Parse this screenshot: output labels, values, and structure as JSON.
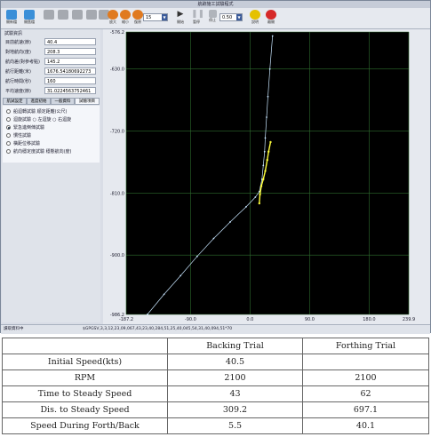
{
  "window": {
    "title": "航跡施工試驗程式",
    "toolbar": {
      "buttons": [
        {
          "label": "開新檔",
          "icon": "new-file-icon",
          "color": "#3a8fd8"
        },
        {
          "label": "開舊檔",
          "icon": "open-file-icon",
          "color": "#3a8fd8"
        },
        {
          "label": "",
          "icon": "cancel-icon",
          "color": "#a5a9b0"
        },
        {
          "label": "",
          "icon": "delete-icon",
          "color": "#a5a9b0"
        },
        {
          "label": "",
          "icon": "stop-icon",
          "color": "#a5a9b0"
        },
        {
          "label": "",
          "icon": "export-icon",
          "color": "#a5a9b0"
        },
        {
          "label": "",
          "icon": "print-icon",
          "color": "#a5a9b0"
        },
        {
          "label": "放大",
          "icon": "zoom-in-icon",
          "color": "#e07a1f"
        },
        {
          "label": "縮小",
          "icon": "zoom-out-icon",
          "color": "#e07a1f"
        },
        {
          "label": "復原",
          "icon": "reset-view-icon",
          "color": "#e07a1f"
        }
      ],
      "zoom_value": "15",
      "playback": [
        {
          "label": "開始",
          "icon": "play-icon",
          "color": "#333333"
        },
        {
          "label": "暫停",
          "icon": "pause-icon",
          "color": "#b0b4bb"
        },
        {
          "label": "停止",
          "icon": "stop-square-icon",
          "color": "#b0b4bb"
        }
      ],
      "speed_value": "0.50",
      "extra": [
        {
          "label": "說明",
          "icon": "help-icon",
          "color": "#e5c100"
        },
        {
          "label": "離開",
          "icon": "exit-icon",
          "color": "#d62828"
        }
      ]
    },
    "info_panel": {
      "title": "試驗資訊",
      "rows": [
        {
          "label": "目前航速(節)",
          "value": "40.4"
        },
        {
          "label": "對地航向(度)",
          "value": "208.3"
        },
        {
          "label": "航向差(對參考點)",
          "value": "145.2"
        },
        {
          "label": "航行距離(米)",
          "value": "1676.54180692273"
        },
        {
          "label": "航行時間(秒)",
          "value": "160"
        },
        {
          "label": "平均速度(節)",
          "value": "31.0224563752461"
        }
      ]
    },
    "tabs": [
      "航試設定",
      "進度初始",
      "一般資料",
      "試驗項目"
    ],
    "active_tab_index": 3,
    "test_items": [
      {
        "label": "船迴轉試驗   順定距離(公尺)",
        "checked": false
      },
      {
        "label": "迴旋試驗   ○ 左迴旋  ○ 右迴旋",
        "checked": false
      },
      {
        "label": "緊急進倒俥試驗",
        "checked": true
      },
      {
        "label": "慣性試驗",
        "checked": false
      },
      {
        "label": "橫距位移試驗",
        "checked": false
      },
      {
        "label": "航向穩定度試驗 穩態航向(度)",
        "checked": false
      }
    ],
    "plot": {
      "x_ticks": [
        "-187.2",
        "-90.0",
        "0.0",
        "90.0",
        "180.0",
        "239.9"
      ],
      "y_ticks": [
        "-576.2",
        "-630.0",
        "-720.0",
        "-810.0",
        "-900.0",
        "-986.2"
      ],
      "track_color": "#c8e6ff",
      "active_track_color": "#ffff3c"
    },
    "status_left": "讀取資料中",
    "status_right": "$GPGSV,3,3,12,23,09,067,43,23,40,284,51,25,40,045,54,31,40,094,51*70"
  },
  "chart_data": {
    "type": "line",
    "xlim": [
      -187.2,
      239.9
    ],
    "ylim": [
      -986.2,
      -576.2
    ],
    "x_ticks": [
      -187.2,
      -90.0,
      0.0,
      90.0,
      180.0,
      239.9
    ],
    "y_ticks": [
      -576.2,
      -630.0,
      -720.0,
      -810.0,
      -900.0,
      -986.2
    ],
    "series": [
      {
        "color": "#c8e6ff",
        "points": [
          [
            -155,
            -986
          ],
          [
            -130,
            -957
          ],
          [
            -105,
            -930
          ],
          [
            -80,
            -902
          ],
          [
            -55,
            -876
          ],
          [
            -30,
            -852
          ],
          [
            -6,
            -830
          ],
          [
            8,
            -816
          ],
          [
            14,
            -808
          ],
          [
            18,
            -790
          ],
          [
            20,
            -770
          ],
          [
            22,
            -750
          ],
          [
            23,
            -730
          ],
          [
            25,
            -700
          ],
          [
            27,
            -670
          ],
          [
            30,
            -630
          ],
          [
            34,
            -582
          ]
        ]
      },
      {
        "color": "#ffff3c",
        "points": [
          [
            14,
            -825
          ],
          [
            15,
            -812
          ],
          [
            17,
            -800
          ],
          [
            20,
            -790
          ],
          [
            23,
            -778
          ],
          [
            26,
            -762
          ],
          [
            28,
            -750
          ],
          [
            31,
            -736
          ]
        ]
      }
    ]
  },
  "table": {
    "headers": [
      "",
      "Backing Trial",
      "Forthing Trial"
    ],
    "rows": [
      {
        "label": "Initial Speed(kts)",
        "backing": "40.5",
        "forthing": ""
      },
      {
        "label": "RPM",
        "backing": "2100",
        "forthing": "2100"
      },
      {
        "label": "Time to Steady Speed",
        "backing": "43",
        "forthing": "62"
      },
      {
        "label": "Dis. to Steady Speed",
        "backing": "309.2",
        "forthing": "697.1"
      },
      {
        "label": "Speed During Forth/Back",
        "backing": "5.5",
        "forthing": "40.1"
      }
    ]
  }
}
